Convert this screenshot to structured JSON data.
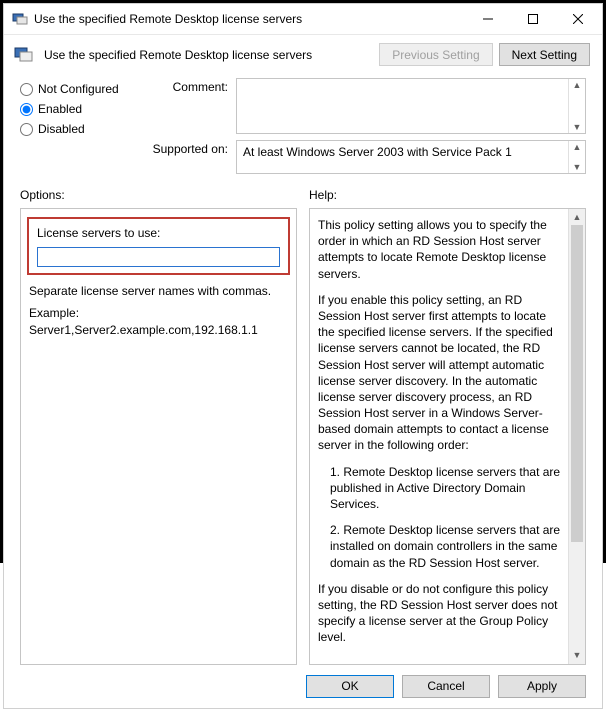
{
  "titlebar": {
    "title": "Use the specified Remote Desktop license servers"
  },
  "header": {
    "title": "Use the specified Remote Desktop license servers",
    "prev_label": "Previous Setting",
    "next_label": "Next Setting"
  },
  "state": {
    "not_configured": "Not Configured",
    "enabled": "Enabled",
    "disabled": "Disabled",
    "selected": "enabled"
  },
  "fields": {
    "comment_label": "Comment:",
    "comment_value": "",
    "supported_label": "Supported on:",
    "supported_value": "At least Windows Server 2003 with Service Pack 1"
  },
  "options": {
    "heading": "Options:",
    "license_label": "License servers to use:",
    "license_value": "",
    "note1": "Separate license server names with commas.",
    "note2": "Example: Server1,Server2.example.com,192.168.1.1"
  },
  "help": {
    "heading": "Help:",
    "p1": "This policy setting allows you to specify the order in which an RD Session Host server attempts to locate Remote Desktop license servers.",
    "p2": "If you enable this policy setting, an RD Session Host server first attempts to locate the specified license servers. If the specified license servers cannot be located, the RD Session Host server will attempt automatic license server discovery. In the automatic license server discovery process, an RD Session Host server in a Windows Server-based domain attempts to contact a license server in the following order:",
    "b1": "1. Remote Desktop license servers that are published in Active Directory Domain Services.",
    "b2": "2. Remote Desktop license servers that are installed on domain controllers in the same domain as the RD Session Host server.",
    "p3": "If you disable or do not configure this policy setting, the RD Session Host server does not specify a license server at the Group Policy level."
  },
  "footer": {
    "ok": "OK",
    "cancel": "Cancel",
    "apply": "Apply"
  },
  "colors": {
    "highlight": "#bf3b33",
    "focus_border": "#2a73d0",
    "ok_border": "#0078d7"
  }
}
